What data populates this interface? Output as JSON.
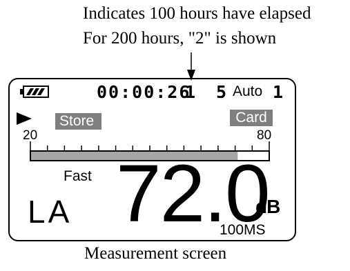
{
  "annotations": {
    "line1": "Indicates 100 hours have elapsed",
    "line2": "For 200 hours, \"2\" is shown"
  },
  "caption": "Measurement screen",
  "display": {
    "battery_icon": "battery-full-icon",
    "elapsed_time": "00:00:26",
    "hours_digit": "1",
    "range_number": "5",
    "auto_label": "Auto",
    "auto_index": "1",
    "play_icon": "play-icon",
    "store_label": "Store",
    "card_label": "Card",
    "scale_min": "20",
    "scale_max": "80",
    "level_bar_fraction": 0.87,
    "time_weighting": "Fast",
    "frequency_weighting": "LA",
    "level_value": "72.0",
    "unit": "dB",
    "interval": "100MS"
  },
  "colors": {
    "tag_background": "#7f7f7f",
    "bar_fill": "#a6a6a6"
  }
}
